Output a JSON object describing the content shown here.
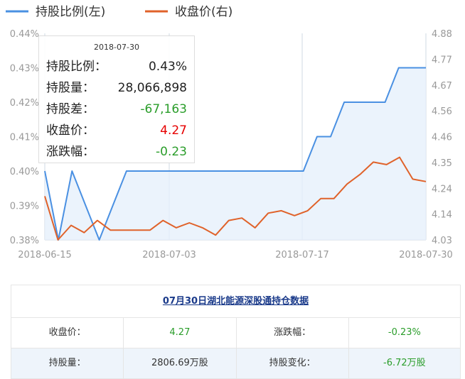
{
  "chart_data": {
    "type": "line",
    "legend": [
      {
        "name": "持股比例(左)",
        "color": "#4a90e2"
      },
      {
        "name": "收盘价(右)",
        "color": "#e0622a"
      }
    ],
    "x_tick_labels": [
      "2018-06-15",
      "2018-07-03",
      "2018-07-17",
      "2018-07-30"
    ],
    "y_left": {
      "ticks": [
        "0.38%",
        "0.39%",
        "0.40%",
        "0.41%",
        "0.42%",
        "0.43%",
        "0.44%"
      ],
      "ylim": [
        0.38,
        0.44
      ]
    },
    "y_right": {
      "ticks": [
        "4.03",
        "4.14",
        "4.24",
        "4.35",
        "4.46",
        "4.56",
        "4.67",
        "4.77",
        "4.88"
      ],
      "ylim": [
        4.03,
        4.88
      ]
    },
    "series": [
      {
        "name": "持股比例(左)",
        "axis": "left",
        "values": [
          0.4,
          0.38,
          0.4,
          0.39,
          0.38,
          0.39,
          0.4,
          0.4,
          0.4,
          0.4,
          0.4,
          0.4,
          0.4,
          0.4,
          0.4,
          0.4,
          0.4,
          0.4,
          0.4,
          0.4,
          0.41,
          0.41,
          0.42,
          0.42,
          0.42,
          0.42,
          0.43,
          0.43,
          0.43
        ]
      },
      {
        "name": "收盘价(右)",
        "axis": "right",
        "values": [
          4.21,
          4.03,
          4.09,
          4.06,
          4.11,
          4.07,
          4.07,
          4.07,
          4.07,
          4.11,
          4.08,
          4.1,
          4.08,
          4.05,
          4.11,
          4.12,
          4.08,
          4.14,
          4.15,
          4.13,
          4.15,
          4.2,
          4.2,
          4.26,
          4.3,
          4.35,
          4.34,
          4.37,
          4.28,
          4.27
        ]
      }
    ],
    "tooltip": {
      "date": "2018-07-30",
      "rows": [
        {
          "label": "持股比例：",
          "value": "0.43%",
          "tone": "normal"
        },
        {
          "label": "持股量：",
          "value": "28,066,898",
          "tone": "normal"
        },
        {
          "label": "持股差：",
          "value": "-67,163",
          "tone": "green"
        },
        {
          "label": "收盘价：",
          "value": "4.27",
          "tone": "red"
        },
        {
          "label": "涨跌幅：",
          "value": "-0.23",
          "tone": "green"
        }
      ]
    }
  },
  "table": {
    "title": "07月30日湖北能源深股通持仓数据",
    "rows": [
      [
        {
          "text": "收盘价：",
          "tone": "normal"
        },
        {
          "text": "4.27",
          "tone": "green"
        },
        {
          "text": "涨跌幅：",
          "tone": "normal"
        },
        {
          "text": "-0.23%",
          "tone": "green"
        }
      ],
      [
        {
          "text": "持股量：",
          "tone": "normal"
        },
        {
          "text": "2806.69万股",
          "tone": "normal"
        },
        {
          "text": "持股变化：",
          "tone": "normal"
        },
        {
          "text": "-6.72万股",
          "tone": "green"
        }
      ]
    ]
  }
}
